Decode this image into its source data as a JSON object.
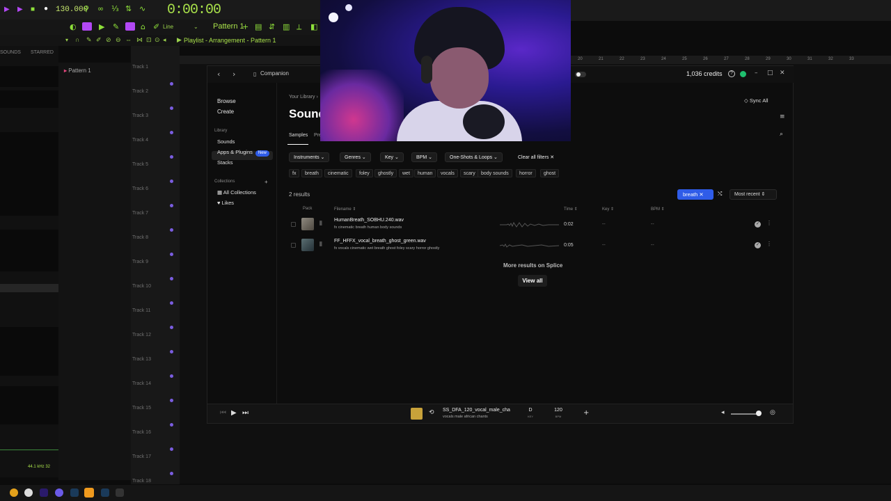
{
  "daw": {
    "tempo": "130.000",
    "time": "0:00:00",
    "pattern_label": "Pattern 1",
    "line_label": "Line",
    "playlist_title": "Playlist - Arrangement - Pattern 1",
    "browser_tab_sounds": "SOUNDS",
    "browser_tab_starred": "STARRED",
    "pattern_item": "Pattern 1",
    "tracks": [
      "Track 1",
      "Track 2",
      "Track 3",
      "Track 4",
      "Track 5",
      "Track 6",
      "Track 7",
      "Track 8",
      "Track 9",
      "Track 10",
      "Track 11",
      "Track 12",
      "Track 13",
      "Track 14",
      "Track 15",
      "Track 16",
      "Track 17",
      "Track 18"
    ],
    "ruler_numbers": [
      "19",
      "20",
      "21",
      "22",
      "23",
      "24",
      "25",
      "26",
      "27",
      "28",
      "29",
      "30",
      "31",
      "32",
      "33"
    ],
    "status": "44.1 kHz 32"
  },
  "splice": {
    "companion": "Companion",
    "credits": "1,036 credits",
    "sidebar": {
      "browse": "Browse",
      "create": "Create",
      "library_heading": "Library",
      "sounds": "Sounds",
      "apps_plugins": "Apps & Plugins",
      "new_badge": "New",
      "stacks": "Stacks",
      "collections_heading": "Collections",
      "all_collections": "All Collections",
      "likes": "Likes"
    },
    "breadcrumb": "Your Library",
    "page_title": "Sounds",
    "tabs": [
      "Samples",
      "Pre"
    ],
    "sync_all": "Sync All",
    "filters": [
      "Instruments",
      "Genres",
      "Key",
      "BPM",
      "One-Shots & Loops"
    ],
    "clear_filters": "Clear all filters",
    "tag_chips": [
      "fx",
      "breath",
      "cinematic",
      "foley",
      "ghostly",
      "wet",
      "human",
      "vocals",
      "scary",
      "body sounds",
      "horror",
      "ghost"
    ],
    "results_count": "2 results",
    "active_tag": "breath",
    "sort_label": "Most recent",
    "columns": {
      "pack": "Pack",
      "filename": "Filename",
      "time": "Time",
      "key": "Key",
      "bpm": "BPM"
    },
    "rows": [
      {
        "name": "HumanBreath_SOBHU.240.wav",
        "tags": "fx   cinematic   breath   human   body sounds",
        "time": "0:02",
        "key": "--",
        "bpm": "--"
      },
      {
        "name": "FF_HFFX_vocal_breath_ghost_green.wav",
        "tags": "fx   vocals   cinematic   wet   breath   ghost   foley   scary   horror   ghostly",
        "time": "0:05",
        "key": "--",
        "bpm": "--"
      }
    ],
    "more_results": "More results on Splice",
    "view_all": "View all",
    "player": {
      "name": "SS_DFA_120_vocal_male_cha",
      "tags": "vocals   male   african   chants",
      "key": "D",
      "key_label": "KEY",
      "bpm": "120",
      "bpm_label": "BPM",
      "volume": 0.85
    }
  },
  "colors": {
    "accent_blue": "#2f5ce8",
    "daw_green": "#a8e04a",
    "daw_purple": "#b248f4",
    "status_green": "#1fbf6e"
  }
}
